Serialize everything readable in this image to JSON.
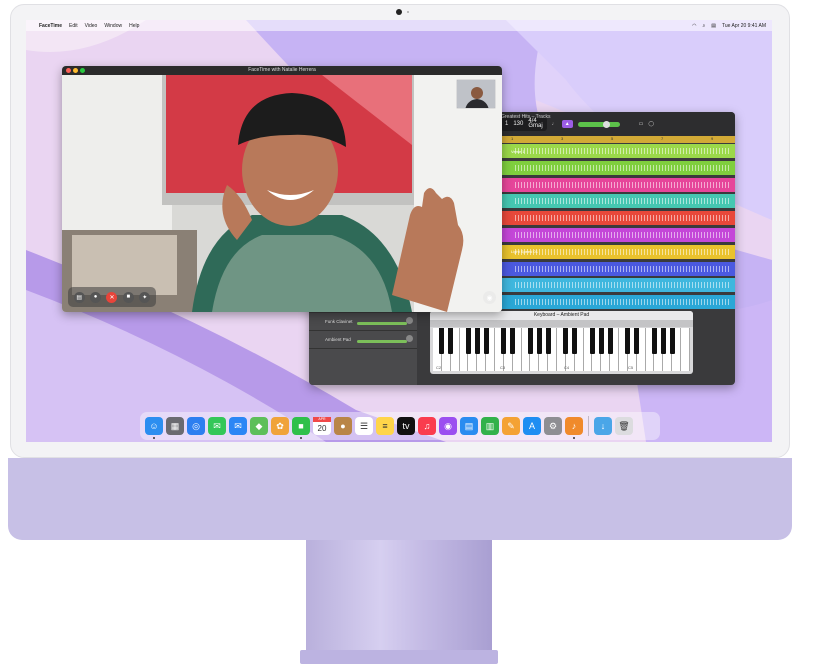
{
  "menubar": {
    "app": "FaceTime",
    "items": [
      "Edit",
      "Video",
      "Window",
      "Help"
    ],
    "clock": "Tue Apr 20  9:41 AM"
  },
  "facetime": {
    "title": "FaceTime with Natalie Herrera"
  },
  "garageband": {
    "title": "Greatest Hits – Tracks",
    "bar": "1",
    "tempo": "130",
    "signature": "4/4",
    "key": "Gmaj",
    "ruler": [
      "1",
      "3",
      "5",
      "7",
      "9"
    ],
    "tracks": [
      {
        "label": "Verse 1",
        "color": "#9bd84a"
      },
      {
        "label": "",
        "color": "#7fcf3e"
      },
      {
        "label": "",
        "color": "#e6469a"
      },
      {
        "label": "",
        "color": "#45c7b1"
      },
      {
        "label": "",
        "color": "#e8483a"
      },
      {
        "label": "",
        "color": "#c447d8"
      },
      {
        "label": "Light Speed 01",
        "color": "#e9c22d"
      },
      {
        "label": "",
        "color": "#4b59e0"
      },
      {
        "label": "",
        "color": "#3fb7de"
      },
      {
        "label": "",
        "color": "#2aa7d6"
      }
    ],
    "track_headers": [
      {
        "name": "Funk Clavinet"
      },
      {
        "name": "Ambient Pad"
      }
    ],
    "keyboard": {
      "title": "Keyboard – Ambient Pad",
      "octave_labels": [
        "C2",
        "C3",
        "C4",
        "C5"
      ]
    }
  },
  "dock": {
    "items": [
      {
        "name": "finder",
        "color": "#2c8ef0",
        "glyph": "☺"
      },
      {
        "name": "launchpad",
        "color": "#6a6a70",
        "glyph": "▦"
      },
      {
        "name": "safari",
        "color": "#2d7ff0",
        "glyph": "◎"
      },
      {
        "name": "messages",
        "color": "#34c759",
        "glyph": "✉"
      },
      {
        "name": "mail",
        "color": "#2b86f5",
        "glyph": "✉"
      },
      {
        "name": "maps",
        "color": "#5dbf5a",
        "glyph": "◆"
      },
      {
        "name": "photos",
        "color": "#f0a33a",
        "glyph": "✿"
      },
      {
        "name": "facetime",
        "color": "#2fc04a",
        "glyph": "■"
      },
      {
        "name": "calendar",
        "color": "#ffffff",
        "glyph": "20",
        "month": "APR"
      },
      {
        "name": "contacts",
        "color": "#b98547",
        "glyph": "●"
      },
      {
        "name": "reminders",
        "color": "#ffffff",
        "glyph": "☰"
      },
      {
        "name": "notes",
        "color": "#ffd54a",
        "glyph": "≡"
      },
      {
        "name": "tv",
        "color": "#111111",
        "glyph": "tv"
      },
      {
        "name": "music",
        "color": "#fa3c4e",
        "glyph": "♫"
      },
      {
        "name": "podcasts",
        "color": "#9b4ff0",
        "glyph": "◉"
      },
      {
        "name": "keynote",
        "color": "#2a8cf0",
        "glyph": "▤"
      },
      {
        "name": "numbers",
        "color": "#32b14a",
        "glyph": "▥"
      },
      {
        "name": "pages",
        "color": "#f4a234",
        "glyph": "✎"
      },
      {
        "name": "app-store",
        "color": "#1f8ef2",
        "glyph": "A"
      },
      {
        "name": "system-preferences",
        "color": "#8e8e93",
        "glyph": "⚙"
      },
      {
        "name": "garageband",
        "color": "#f08a2b",
        "glyph": "♪"
      },
      {
        "name": "downloads",
        "color": "#4aa6e8",
        "glyph": "↓"
      },
      {
        "name": "trash",
        "color": "#dcdcdf",
        "glyph": "🗑"
      }
    ]
  }
}
